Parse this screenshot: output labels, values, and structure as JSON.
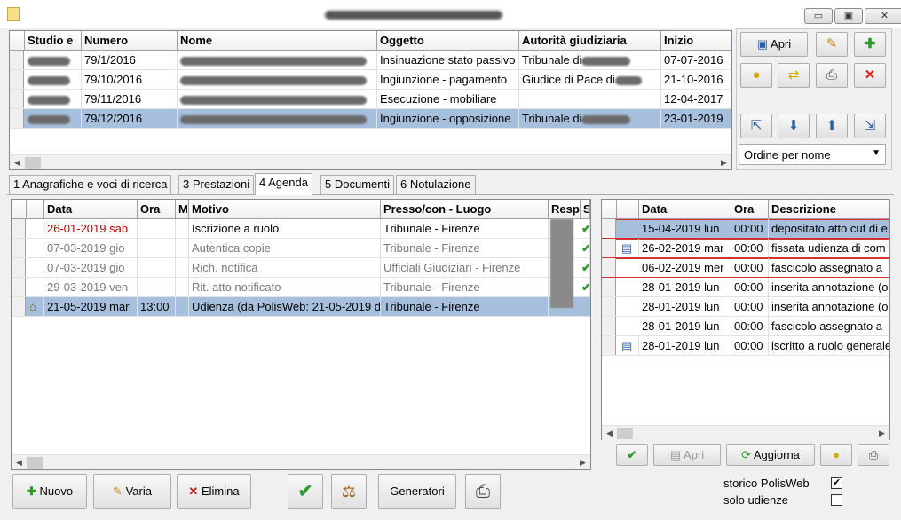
{
  "window": {
    "title": "",
    "min": "▭",
    "max": "▣",
    "close": "✕"
  },
  "top_grid": {
    "columns": [
      "Studio e",
      "Numero",
      "Nome",
      "Oggetto",
      "Autorità giudiziaria",
      "Inizio"
    ],
    "rows": [
      {
        "numero": "79/1/2016",
        "oggetto": "Insinuazione stato passivo",
        "autorita": "Tribunale di",
        "inizio": "07-07-2016"
      },
      {
        "numero": "79/10/2016",
        "oggetto": "Ingiunzione - pagamento",
        "autorita": "Giudice di Pace di",
        "inizio": "21-10-2016"
      },
      {
        "numero": "79/11/2016",
        "oggetto": "Esecuzione - mobiliare",
        "autorita": "",
        "inizio": "12-04-2017"
      },
      {
        "numero": "79/12/2016",
        "oggetto": "Ingiunzione - opposizione",
        "autorita": "Tribunale di",
        "inizio": "23-01-2019"
      }
    ]
  },
  "side_panel": {
    "apri_label": "Apri",
    "order_select": "Ordine per nome"
  },
  "tabs": [
    "1 Anagrafiche e voci di ricerca",
    "3 Prestazioni",
    "4 Agenda",
    "5 Documenti",
    "6 Notulazione"
  ],
  "agenda_grid": {
    "columns": [
      "Data",
      "Ora",
      "M",
      "Motivo",
      "Presso/con - Luogo",
      "Resp",
      "S"
    ],
    "rows": [
      {
        "data": "26-01-2019 sab",
        "ora": "",
        "motivo": "Iscrizione a ruolo",
        "luogo": "Tribunale - Firenze",
        "s": "✔"
      },
      {
        "data": "07-03-2019 gio",
        "ora": "",
        "motivo": "Autentica copie",
        "luogo": "Tribunale - Firenze",
        "s": "✔"
      },
      {
        "data": "07-03-2019 gio",
        "ora": "",
        "motivo": "Rich. notifica",
        "luogo": "Ufficiali Giudiziari - Firenze",
        "s": "✔"
      },
      {
        "data": "29-03-2019 ven",
        "ora": "",
        "motivo": "Rit. atto notificato",
        "luogo": "Tribunale - Firenze",
        "s": "✔"
      },
      {
        "data": "21-05-2019 mar",
        "ora": "13:00",
        "motivo": "Udienza (da PolisWeb: 21-05-2019 d",
        "luogo": "Tribunale - Firenze",
        "s": ""
      }
    ]
  },
  "polis_grid": {
    "columns": [
      "Data",
      "Ora",
      "Descrizione"
    ],
    "rows": [
      {
        "data": "15-04-2019 lun",
        "ora": "00:00",
        "descr": "depositato atto cuf di e"
      },
      {
        "data": "26-02-2019 mar",
        "ora": "00:00",
        "descr": "fissata udienza di com"
      },
      {
        "data": "06-02-2019 mer",
        "ora": "00:00",
        "descr": "fascicolo assegnato a"
      },
      {
        "data": "28-01-2019 lun",
        "ora": "00:00",
        "descr": "inserita annotazione (o"
      },
      {
        "data": "28-01-2019 lun",
        "ora": "00:00",
        "descr": "inserita annotazione (o"
      },
      {
        "data": "28-01-2019 lun",
        "ora": "00:00",
        "descr": "fascicolo assegnato a"
      },
      {
        "data": "28-01-2019 lun",
        "ora": "00:00",
        "descr": "iscritto a ruolo generale"
      }
    ],
    "apri_label": "Apri",
    "aggiorna_label": "Aggiorna"
  },
  "bottom_buttons": {
    "nuovo": "Nuovo",
    "varia": "Varia",
    "elimina": "Elimina",
    "generatori": "Generatori"
  },
  "options": {
    "storico_label": "storico PolisWeb",
    "storico_checked": true,
    "solo_udienze_label": "solo udienze",
    "solo_udienze_checked": false
  }
}
